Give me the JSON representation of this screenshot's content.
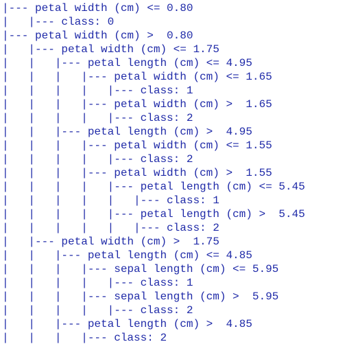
{
  "tree_text": {
    "lines": [
      "|--- petal width (cm) <= 0.80",
      "|   |--- class: 0",
      "|--- petal width (cm) >  0.80",
      "|   |--- petal width (cm) <= 1.75",
      "|   |   |--- petal length (cm) <= 4.95",
      "|   |   |   |--- petal width (cm) <= 1.65",
      "|   |   |   |   |--- class: 1",
      "|   |   |   |--- petal width (cm) >  1.65",
      "|   |   |   |   |--- class: 2",
      "|   |   |--- petal length (cm) >  4.95",
      "|   |   |   |--- petal width (cm) <= 1.55",
      "|   |   |   |   |--- class: 2",
      "|   |   |   |--- petal width (cm) >  1.55",
      "|   |   |   |   |--- petal length (cm) <= 5.45",
      "|   |   |   |   |   |--- class: 1",
      "|   |   |   |   |--- petal length (cm) >  5.45",
      "|   |   |   |   |   |--- class: 2",
      "|   |--- petal width (cm) >  1.75",
      "|   |   |--- petal length (cm) <= 4.85",
      "|   |   |   |--- sepal length (cm) <= 5.95",
      "|   |   |   |   |--- class: 1",
      "|   |   |   |--- sepal length (cm) >  5.95",
      "|   |   |   |   |--- class: 2",
      "|   |   |--- petal length (cm) >  4.85",
      "|   |   |   |--- class: 2"
    ]
  },
  "colors": {
    "text": "#1f2aa8",
    "background": "#ffffff"
  }
}
